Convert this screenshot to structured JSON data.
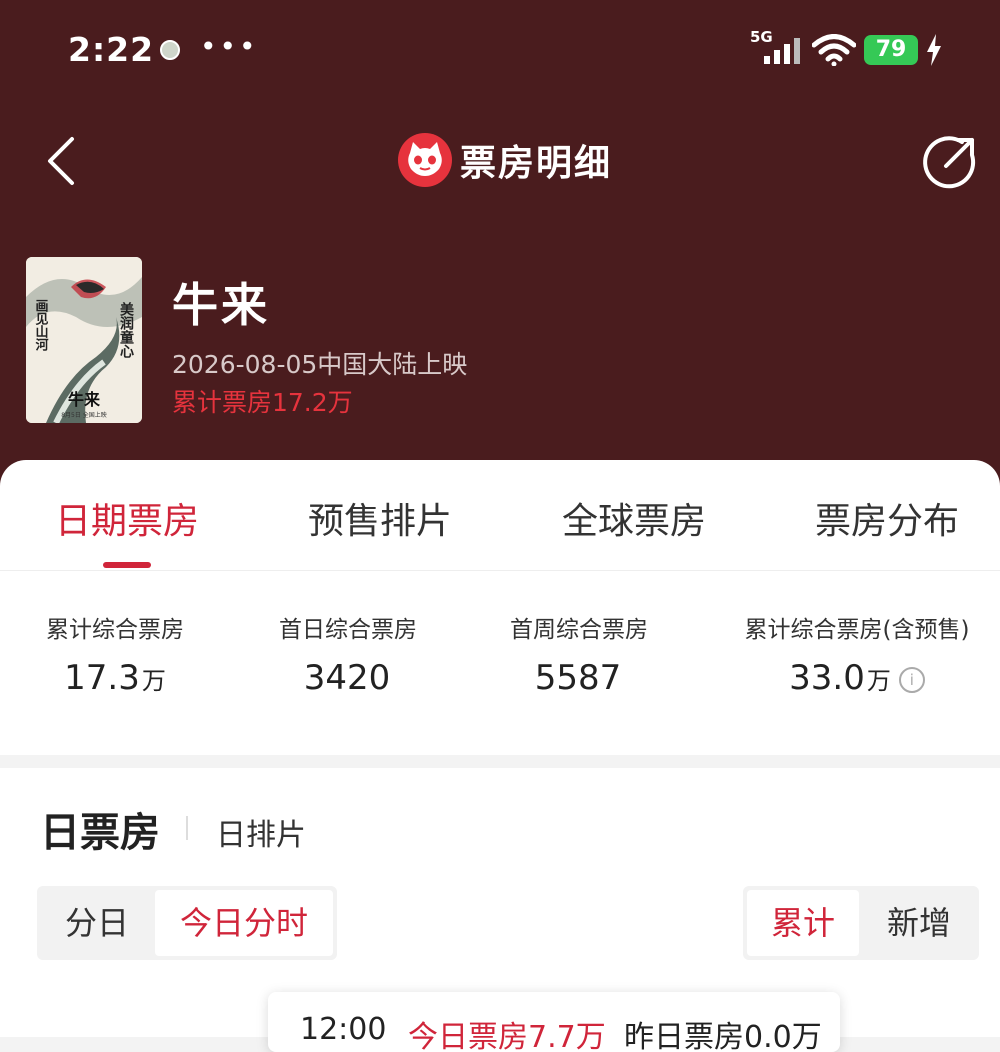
{
  "status_bar": {
    "time": "2:22",
    "dots": "•••",
    "network": "5G",
    "battery": "79"
  },
  "nav": {
    "title": "票房明细",
    "back_icon": "chevron-left-icon",
    "share_icon": "share-icon"
  },
  "movie": {
    "title": "牛来",
    "release": "2026-08-05中国大陆上映",
    "box_office": "累计票房17.2万",
    "poster_texts": [
      "美润童心",
      "画见山河",
      "牛来",
      "8月5日 全国上映"
    ]
  },
  "tabs": [
    {
      "label": "日期票房",
      "active": true
    },
    {
      "label": "预售排片",
      "active": false
    },
    {
      "label": "全球票房",
      "active": false
    },
    {
      "label": "票房分布",
      "active": false
    }
  ],
  "stats": [
    {
      "label": "累计综合票房",
      "value": "17.3",
      "unit": "万"
    },
    {
      "label": "首日综合票房",
      "value": "3420",
      "unit": ""
    },
    {
      "label": "首周综合票房",
      "value": "5587",
      "unit": ""
    },
    {
      "label": "累计综合票房(含预售)",
      "value": "33.0",
      "unit": "万"
    }
  ],
  "section": {
    "title": "日票房",
    "subtitle": "日排片"
  },
  "segment_left": [
    {
      "label": "分日",
      "active": false
    },
    {
      "label": "今日分时",
      "active": true
    }
  ],
  "segment_right": [
    {
      "label": "累计",
      "active": true
    },
    {
      "label": "新增",
      "active": false
    }
  ],
  "tooltip": {
    "time": "12:00",
    "today": "今日票房7.7万",
    "yesterday": "昨日票房0.0万"
  },
  "colors": {
    "header_bg": "#4a1c1e",
    "accent": "#d0253a",
    "battery": "#35c956"
  }
}
